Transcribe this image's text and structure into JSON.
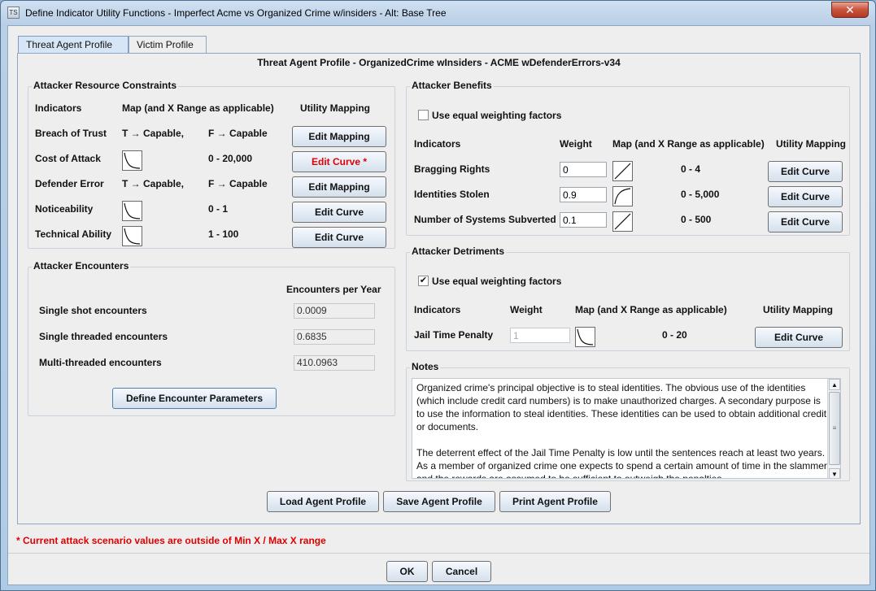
{
  "window": {
    "title": "Define Indicator Utility Functions - Imperfect Acme vs Organized Crime w/insiders - Alt: Base Tree",
    "app_icon": "app-icon",
    "close_label": "✕"
  },
  "tabs": [
    {
      "label": "Threat Agent Profile",
      "active": true
    },
    {
      "label": "Victim Profile",
      "active": false
    }
  ],
  "panel_title": "Threat Agent Profile - OrganizedCrime wInsiders - ACME wDefenderErrors-v34",
  "resource_constraints": {
    "legend": "Attacker Resource Constraints",
    "headers": {
      "indicators": "Indicators",
      "map": "Map (and X Range as applicable)",
      "utility": "Utility Mapping"
    },
    "rows": [
      {
        "indicator": "Breach of Trust",
        "map_left": "T → Capable,",
        "range": "F → Capable",
        "button": "Edit Mapping",
        "curve": false
      },
      {
        "indicator": "Cost of Attack",
        "map_left": "",
        "range": "0 - 20,000",
        "button": "Edit Curve *",
        "curve": true,
        "warn": true
      },
      {
        "indicator": "Defender Error",
        "map_left": "T → Capable,",
        "range": "F → Capable",
        "button": "Edit Mapping",
        "curve": false
      },
      {
        "indicator": "Noticeability",
        "map_left": "",
        "range": "0 - 1",
        "button": "Edit Curve",
        "curve": true
      },
      {
        "indicator": "Technical Ability",
        "map_left": "",
        "range": "1 - 100",
        "button": "Edit Curve",
        "curve": true,
        "range_bold": true
      }
    ]
  },
  "encounters": {
    "legend": "Attacker Encounters",
    "header": "Encounters per Year",
    "rows": [
      {
        "label": "Single shot encounters",
        "value": "0.0009"
      },
      {
        "label": "Single threaded encounters",
        "value": "0.6835"
      },
      {
        "label": "Multi-threaded encounters",
        "value": "410.0963"
      }
    ],
    "define_button": "Define Encounter Parameters"
  },
  "benefits": {
    "legend": "Attacker Benefits",
    "equal_weighting_label": "Use equal weighting factors",
    "equal_weighting_checked": false,
    "headers": {
      "indicators": "Indicators",
      "weight": "Weight",
      "map": "Map (and X Range as applicable)",
      "utility": "Utility Mapping"
    },
    "rows": [
      {
        "indicator": "Bragging Rights",
        "weight": "0",
        "range": "0 - 4",
        "button": "Edit Curve",
        "curve_type": "linear"
      },
      {
        "indicator": "Identities Stolen",
        "weight": "0.9",
        "range": "0 - 5,000",
        "button": "Edit Curve",
        "curve_type": "concave"
      },
      {
        "indicator": "Number of Systems Subverted",
        "weight": "0.1",
        "range": "0 - 500",
        "button": "Edit Curve",
        "curve_type": "linear"
      }
    ]
  },
  "detriments": {
    "legend": "Attacker Detriments",
    "equal_weighting_label": "Use equal weighting factors",
    "equal_weighting_checked": true,
    "check_mark": "✔",
    "headers": {
      "indicators": "Indicators",
      "weight": "Weight",
      "map": "Map (and X Range as applicable)",
      "utility": "Utility Mapping"
    },
    "rows": [
      {
        "indicator": "Jail Time Penalty",
        "weight": "1",
        "range": "0 - 20",
        "button": "Edit Curve"
      }
    ]
  },
  "notes": {
    "legend": "Notes",
    "paragraphs": [
      "Organized crime's principal objective is to steal identities.  The obvious use of the identities (which include credit card numbers) is to make unauthorized charges.  A secondary purpose is to use the information to steal identities.  These identities can be used to obtain additional credit or documents.",
      "The deterrent effect of the Jail Time Penalty is low until the sentences reach at least two years. As a member of organized crime one expects to spend a certain amount of time in the slammer and the rewards are assumed to be sufficient  to outweigh the penalties."
    ]
  },
  "bottom_buttons": {
    "load": "Load Agent Profile",
    "save": "Save Agent Profile",
    "print": "Print Agent Profile"
  },
  "footnote": "* Current attack scenario values are outside of Min X / Max X range",
  "dialog": {
    "ok": "OK",
    "cancel": "Cancel"
  }
}
